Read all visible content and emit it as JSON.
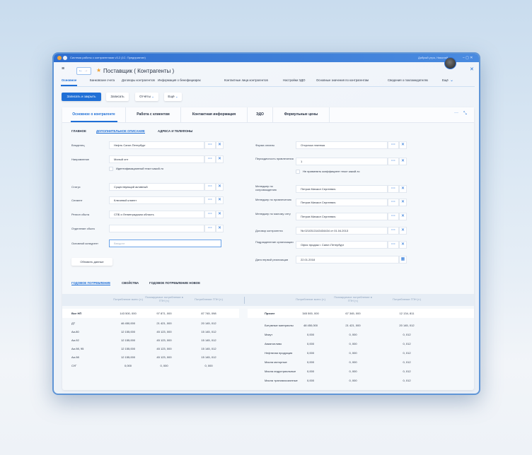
{
  "window": {
    "title": "Система работы с контрагентами v3.2 (1С: Предприятие)",
    "greeting": "Добрый утро, Николай"
  },
  "header": {
    "title": "Поставщик ( Контрагенты )"
  },
  "nav_tabs": [
    "Основное",
    "Банковские счета",
    "Договоры контрагентов",
    "Информация о бенефициарах",
    "Контактные лица контрагентов",
    "Настройки ЭДО",
    "Основные значения по контрагентам",
    "Сведения о поклажедателях",
    "Ещё"
  ],
  "toolbar": {
    "save_close": "Записать и закрыть",
    "save": "Записать",
    "reports": "Отчёты",
    "more": "Ещё"
  },
  "main_tabs": [
    "Основное о контрагенте",
    "Работа с клиентом",
    "Контактная информация",
    "ЭДО",
    "Формульные цены"
  ],
  "sub_tabs": [
    "ГЛАВНОЕ",
    "ДОПОЛНИТЕЛЬНОЕ ОПИСАНИЕ",
    "АДРЕСА И ТЕЛЕФОНЫ"
  ],
  "left_form": {
    "fields": [
      {
        "label": "Владелец",
        "value": "Нефть Санкт-Петербург"
      },
      {
        "label": "Направление",
        "value": "Малый опт"
      },
      {
        "label": "Статус",
        "value": "Существующий активный"
      },
      {
        "label": "Сегмент",
        "value": "Ключевой клиент"
      },
      {
        "label": "Регион сбыта",
        "value": "СПБ и Ленинградская область"
      },
      {
        "label": "Отделение сбыта",
        "value": ""
      }
    ],
    "checkbox": "Идентификационный текст какой-то",
    "main_competitor": {
      "label": "Основной конкурент",
      "placeholder": "Введите"
    },
    "refresh_button": "Обновить данные"
  },
  "right_form": {
    "fields": [
      {
        "label": "Форма оплаты",
        "value": "Отсрочка платежа"
      },
      {
        "label": "Периодичность привлечения",
        "value": "1"
      },
      {
        "label": "Менеджер по сопровождению",
        "value": "Петров Михаил Сергеевич"
      },
      {
        "label": "Менеджер по привлечению",
        "value": "Петров Михаил Сергеевич"
      },
      {
        "label": "Менеджер по малому опту",
        "value": "Петров Михаил Сергеевич"
      },
      {
        "label": "Договор контрагента",
        "value": "№ 0210313143434434 от 01.04.2013"
      },
      {
        "label": "Подразделение организации",
        "value": "Офис продаж г. Санкт-Петербург"
      }
    ],
    "checkbox": "Не применять коэффициент текст какой-то",
    "date": {
      "label": "Дата первой реализации",
      "value": "22.01.2018"
    }
  },
  "bottom_tabs": [
    "ГОДОВОЕ ПОТРЕБЛЕНИЕ",
    "СВОЙСТВА",
    "ГОДОВОЕ ПОТРЕБЛЕНИЕ НОВОЕ"
  ],
  "table_left": {
    "headers": [
      "Потребление всего (т.)",
      "Планируемое потребление в ГПН (т.)",
      "Потребление ГПН (т.)"
    ],
    "rows": [
      [
        "Все НП",
        "143 500, 000",
        "97 871, 000",
        "87 745, 098"
      ],
      [
        "ДТ",
        "46 450,000",
        "21 421, 000",
        "20 145, 012"
      ],
      [
        "Аи-80",
        "12 155,000",
        "45 123, 000",
        "15 145, 012"
      ],
      [
        "Аи-92",
        "12 155,000",
        "45 123, 000",
        "15 145, 012"
      ],
      [
        "Аи-98, 95",
        "12 155,000",
        "45 123, 000",
        "15 145, 012"
      ],
      [
        "Аи-98",
        "12 155,000",
        "45 123, 000",
        "15 145, 012"
      ],
      [
        "СУГ",
        "0,000",
        "0, 000",
        "0, 000"
      ]
    ]
  },
  "table_right": {
    "headers": [
      "Потребление всего (т.)",
      "Планируемое потребление в ГПН (т.)",
      "Потребление ГПН (т.)"
    ],
    "rows": [
      [
        "Прочее",
        "345 500, 000",
        "67 345, 000",
        "12 134, 811"
      ],
      [
        "Битумные материалы",
        "48 450,000",
        "21 421, 000",
        "20 145, 012"
      ],
      [
        "Мазут",
        "0,000",
        "0, 000",
        "0, 012"
      ],
      [
        "Авиатопливо",
        "0,000",
        "0, 000",
        "0, 012"
      ],
      [
        "Нефтяная продукция",
        "0,000",
        "0, 000",
        "0, 012"
      ],
      [
        "Масла моторные",
        "0,000",
        "0, 000",
        "0, 012"
      ],
      [
        "Масла индустриальные",
        "0,000",
        "0, 000",
        "0, 012"
      ],
      [
        "Масла трансмиссионные",
        "0,000",
        "0, 000",
        "0, 012"
      ]
    ]
  }
}
